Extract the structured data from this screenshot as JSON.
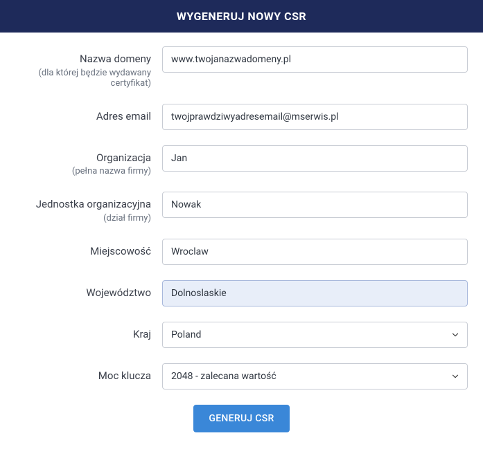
{
  "header": {
    "title": "WYGENERUJ NOWY CSR"
  },
  "fields": {
    "domain": {
      "label": "Nazwa domeny",
      "sublabel": "(dla której będzie wydawany certyfikat)",
      "value": "www.twojanazwadomeny.pl"
    },
    "email": {
      "label": "Adres email",
      "value": "twojprawdziwyadresemail@mserwis.pl"
    },
    "organization": {
      "label": "Organizacja",
      "sublabel": "(pełna nazwa firmy)",
      "value": "Jan"
    },
    "orgunit": {
      "label": "Jednostka organizacyjna",
      "sublabel": "(dział firmy)",
      "value": "Nowak"
    },
    "city": {
      "label": "Miejscowość",
      "value": "Wroclaw"
    },
    "state": {
      "label": "Województwo",
      "value": "Dolnoslaskie"
    },
    "country": {
      "label": "Kraj",
      "selected": "Poland"
    },
    "keysize": {
      "label": "Moc klucza",
      "selected": "2048 - zalecana wartość"
    }
  },
  "button": {
    "generate": "GENERUJ CSR"
  }
}
